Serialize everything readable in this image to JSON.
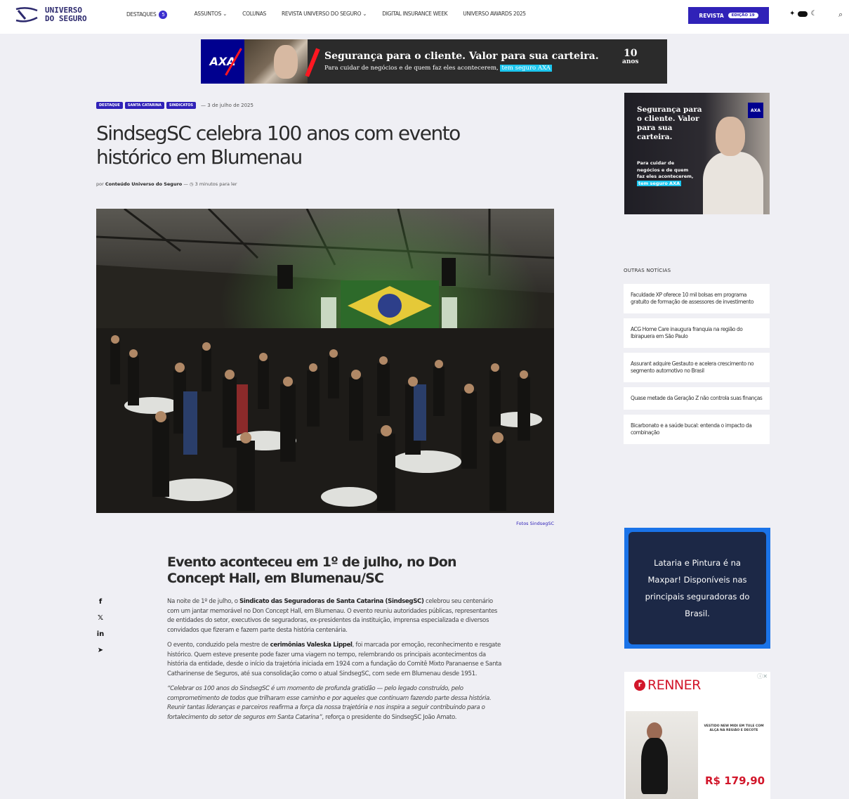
{
  "header": {
    "logo": {
      "line1": "UNIVERSO",
      "line2": "DO SEGURO"
    },
    "nav": [
      {
        "label": "DESTAQUES",
        "badge": "5"
      },
      {
        "label": "ASSUNTOS"
      },
      {
        "label": "COLUNAS"
      },
      {
        "label": "REVISTA UNIVERSO DO SEGURO"
      },
      {
        "label": "DIGITAL INSURANCE WEEK"
      },
      {
        "label": "UNIVERSO AWARDS 2025"
      }
    ],
    "revista_button": {
      "label": "REVISTA",
      "edition": "EDIÇÃO 19"
    },
    "icons": [
      "sun-icon",
      "toggle-icon",
      "moon-icon",
      "search-icon"
    ]
  },
  "top_banner": {
    "brand": "AXA",
    "headline": "Segurança para o cliente. Valor para sua carteira.",
    "subline": "Para cuidar de negócios e de quem faz eles acontecerem,",
    "highlight": "tem seguro AXA",
    "anniversary_number": "10",
    "anniversary_word": "anos"
  },
  "article": {
    "tags": [
      "DESTAQUE",
      "SANTA CATARINA",
      "SINDICATOS"
    ],
    "date": "— 3 de julho de 2025",
    "title": "SindsegSC celebra 100 anos com evento histórico em Blumenau",
    "byline_prefix": "por",
    "author": "Conteúdo Universo do Seguro",
    "read_time": "— ◷ 3 minutos para ler",
    "photo_credit": "Fotos SindsegSC",
    "subtitle": "Evento aconteceu em 1º de julho, no Don Concept Hall, em Blumenau/SC",
    "p1_a": "Na noite de 1º de julho, o ",
    "p1_b": "Sindicato das Seguradoras de Santa Catarina (SindsegSC)",
    "p1_c": " celebrou seu centenário com um jantar memorável no Don Concept Hall, em Blumenau. O evento reuniu autoridades públicas, representantes de entidades do setor, executivos de seguradoras, ex-presidentes da instituição, imprensa especializada e diversos convidados que fizeram e fazem parte desta história centenária.",
    "p2_a": "O evento, conduzido pela mestre de ",
    "p2_b": "cerimônias Valeska Lippel",
    "p2_c": ", foi marcada por emoção, reconhecimento e resgate histórico. Quem esteve presente pode fazer uma viagem no tempo, relembrando os principais acontecimentos da história da entidade, desde o início da trajetória iniciada em 1924 com a fundação do Comitê Mixto Paranaense e Santa Catharinense de Seguros, até sua consolidação como o atual SindsegSC, com sede em Blumenau desde 1951.",
    "p3_quote": "“Celebrar os 100 anos do SindsegSC é um momento de profunda gratidão — pelo legado construído, pelo comprometimento de todos que trilharam esse caminho e por aqueles que continuam fazendo parte dessa história. Reunir tantas lideranças e parceiros reafirma a força da nossa trajetória e nos inspira a seguir contribuindo para o fortalecimento do setor de seguros em Santa Catarina”",
    "p3_tail": ", reforça o presidente do SindsegSC João Amato."
  },
  "share": [
    "facebook-icon",
    "x-icon",
    "linkedin-icon",
    "telegram-icon"
  ],
  "sidebar": {
    "axa_ad": {
      "headline": "Segurança para o cliente. Valor para sua carteira.",
      "sub": "Para cuidar de negócios e de quem faz eles acontecerem,",
      "highlight": "tem seguro AXA",
      "brand": "AXA"
    },
    "other_news_heading": "OUTRAS NOTÍCIAS",
    "other_news": [
      "Faculdade XP oferece 10 mil bolsas em programa gratuito de formação de assessores de investimento",
      "ACG Home Care inaugura franquia na região do Ibirapuera em São Paulo",
      "Assurant adquire Gestauto e acelera crescimento no segmento automotivo no Brasil",
      "Quase metade da Geração Z não controla suas finanças",
      "Bicarbonato e a saúde bucal: entenda o impacto da combinação"
    ],
    "maxpar_ad": "Lataria e Pintura é na Maxpar! Disponíveis nas principais seguradoras do Brasil.",
    "renner_ad": {
      "brand": "RENNER",
      "description": "VESTIDO NEW MIDI EM TULE COM ALÇA NA REGIÃO E DECOTE",
      "price": "R$ 179,90"
    }
  }
}
